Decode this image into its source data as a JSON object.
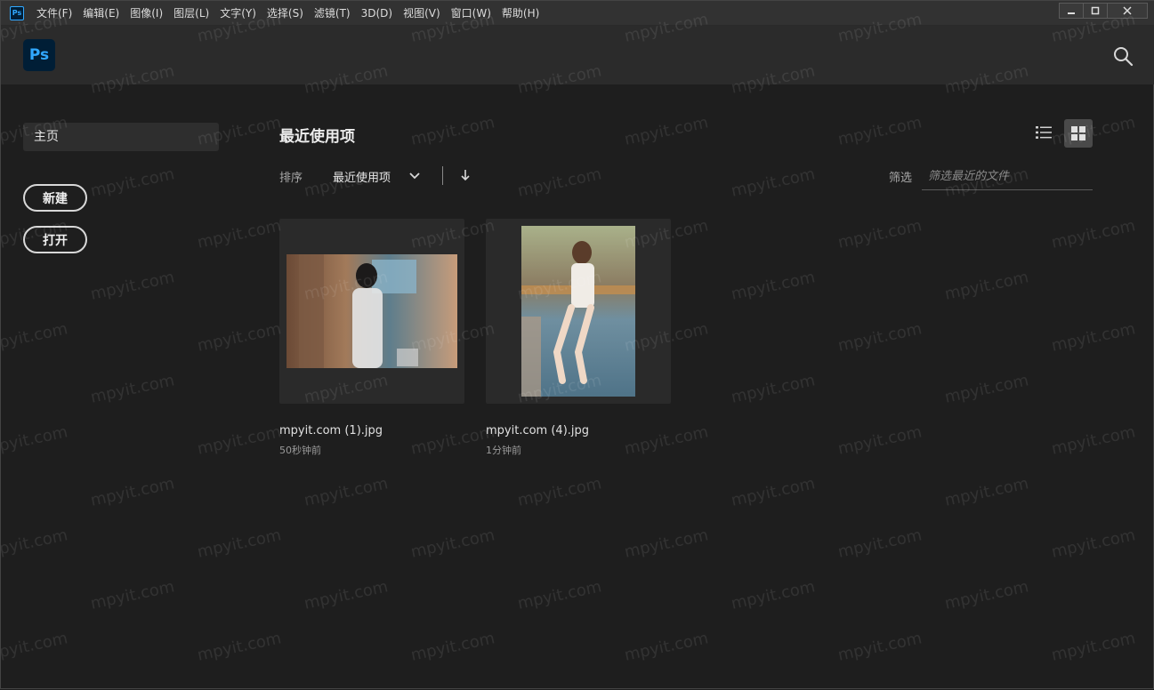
{
  "menubar": {
    "app_icon": "Ps",
    "items": [
      "文件(F)",
      "编辑(E)",
      "图像(I)",
      "图层(L)",
      "文字(Y)",
      "选择(S)",
      "滤镜(T)",
      "3D(D)",
      "视图(V)",
      "窗口(W)",
      "帮助(H)"
    ]
  },
  "window_controls": {
    "minimize": "minimize-icon",
    "maximize": "maximize-icon",
    "close": "close-icon"
  },
  "header": {
    "logo": "Ps",
    "search": "search-icon"
  },
  "sidebar": {
    "home_label": "主页",
    "new_label": "新建",
    "open_label": "打开"
  },
  "main": {
    "title": "最近使用项",
    "sort_label": "排序",
    "sort_value": "最近使用项",
    "filter_label": "筛选",
    "filter_placeholder": "筛选最近的文件",
    "view_modes": [
      "list-view-icon",
      "grid-view-icon"
    ],
    "active_view": "grid",
    "files": [
      {
        "name": "mpyit.com (1).jpg",
        "time": "50秒钟前"
      },
      {
        "name": "mpyit.com (4).jpg",
        "time": "1分钟前"
      }
    ]
  },
  "watermark_text": "mpyit.com",
  "colors": {
    "accent": "#31a8ff",
    "logo_bg": "#001e36",
    "background": "#1e1e1e",
    "header": "#2b2b2b"
  }
}
